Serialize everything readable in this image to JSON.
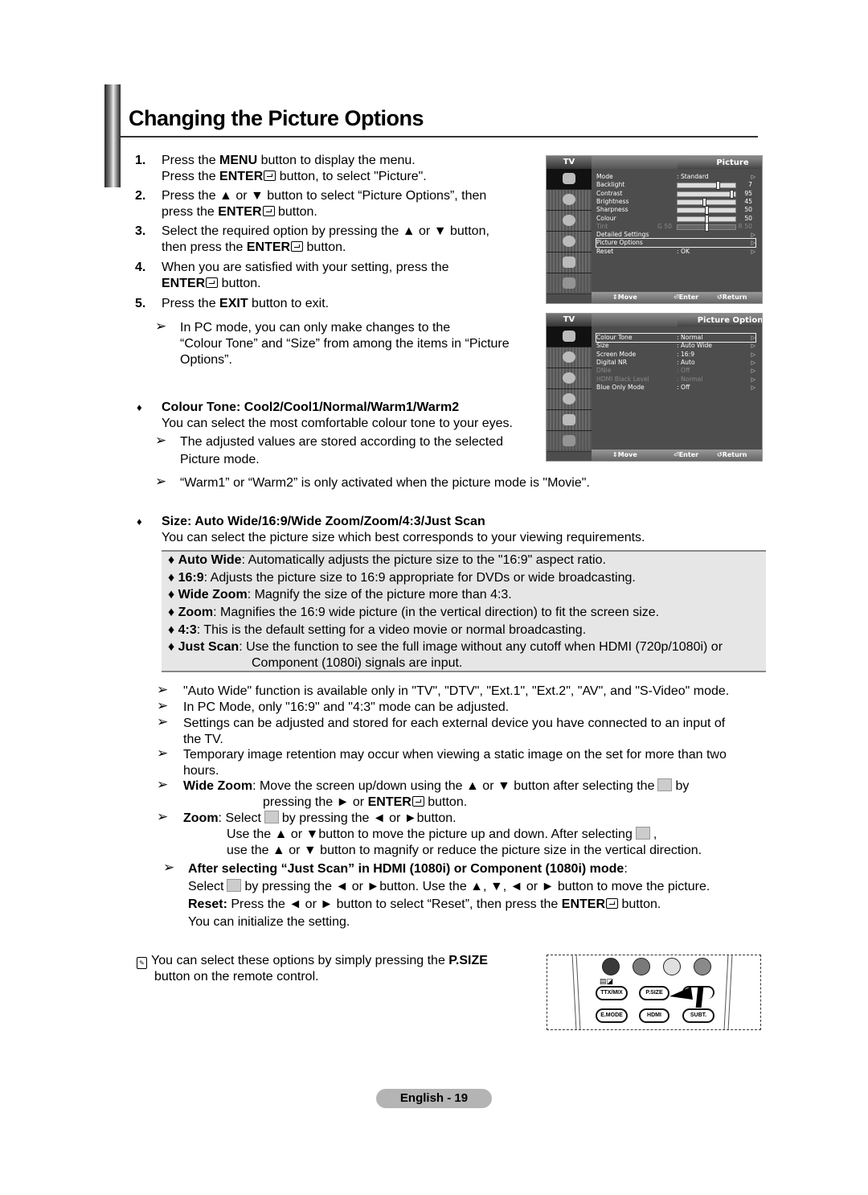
{
  "page": {
    "title": "Changing the Picture Options",
    "footer": "English - 19"
  },
  "steps": [
    {
      "num": "1.",
      "parts": [
        "Press the ",
        "MENU",
        " button to display the menu."
      ],
      "line2": [
        "Press the ",
        "ENTER",
        " button, to select \"Picture\"."
      ]
    },
    {
      "num": "2.",
      "text_a": "Press the ▲ or ▼ button to select “Picture Options”, then",
      "text_b_pre": "press the ",
      "text_b_bold": "ENTER",
      "text_b_post": " button."
    },
    {
      "num": "3.",
      "text_a": "Select the required option by pressing the ▲ or ▼ button,",
      "text_b_pre": "then press the ",
      "text_b_bold": "ENTER",
      "text_b_post": " button."
    },
    {
      "num": "4.",
      "text_a": "When you are satisfied with your setting, press the",
      "text_b_pre": "",
      "text_b_bold": "ENTER",
      "text_b_post": " button."
    },
    {
      "num": "5.",
      "pre": "Press the ",
      "bold": "EXIT",
      "post": " button to exit."
    }
  ],
  "notes": {
    "pc_mode": [
      "In PC mode, you can only make changes to the",
      "“Colour Tone” and “Size” from among the items in “Picture",
      "Options”."
    ],
    "stored": [
      "The adjusted values are stored according to the selected",
      "Picture mode."
    ],
    "warm": "“Warm1” or “Warm2” is only activated when the picture mode is \"Movie\".",
    "arrow_glyph": "➢"
  },
  "colour_tone": {
    "heading": "Colour Tone: Cool2/Cool1/Normal/Warm1/Warm2",
    "desc": "You can select the most comfortable colour tone to your eyes."
  },
  "size": {
    "heading": "Size: Auto Wide/16:9/Wide Zoom/Zoom/4:3/Just Scan",
    "desc": "You can select the picture size which best corresponds to your viewing requirements.",
    "options": [
      {
        "name": "Auto Wide",
        "desc": ": Automatically adjusts the picture size to the \"16:9\" aspect ratio."
      },
      {
        "name": "16:9",
        "desc": ": Adjusts the picture size to 16:9 appropriate for DVDs or wide broadcasting."
      },
      {
        "name": "Wide Zoom",
        "desc": ": Magnify the size of the picture more than 4:3."
      },
      {
        "name": "Zoom",
        "desc": ": Magnifies the 16:9 wide picture (in the vertical direction) to fit the screen size."
      },
      {
        "name": "4:3",
        "desc": ": This is the default setting for a video movie or normal broadcasting."
      },
      {
        "name": "Just Scan",
        "desc": ": Use the function to see the full image without any cutoff when HDMI (720p/1080i) or",
        "desc2": "Component (1080i) signals are input."
      }
    ]
  },
  "size_notes": [
    "\"Auto Wide\" function is available only in \"TV\", \"DTV\", \"Ext.1\", \"Ext.2\", \"AV\", and \"S-Video\" mode.",
    "In PC Mode, only \"16:9\" and \"4:3\" mode can be adjusted.",
    "Settings can be adjusted and stored for each external device you have connected to an input of",
    "the TV.",
    "Temporary image retention may occur when viewing a static image on the set for more than two",
    "hours."
  ],
  "wide_zoom_note": {
    "bold": "Wide Zoom",
    "line1_a": ": Move the screen up/down using the ▲ or ▼ button after selecting the",
    "line1_b": "by",
    "line2_a": "pressing the ► or ",
    "line2_bold": "ENTER",
    "line2_b": " button."
  },
  "zoom_note": {
    "bold": "Zoom",
    "line1_a": ": Select",
    "line1_b": "by pressing the ◄ or ►button.",
    "line2_a": "Use the ▲ or ▼button to move the picture up and down. After selecting",
    "line2_b": ",",
    "line3": "use the ▲ or ▼ button to magnify or reduce the picture size in the vertical direction."
  },
  "just_scan_note": {
    "heading_bold": "After selecting “Just Scan” in HDMI (1080i) or Component (1080i) mode",
    "heading_tail": ":",
    "line1_a": "Select",
    "line1_b": "by pressing the ◄ or ►button. Use the ▲, ▼, ◄ or ► button to move the picture.",
    "reset_bold": "Reset:",
    "reset_a": " Press the ◄ or ► button to select “Reset”, then press the ",
    "reset_enter": "ENTER",
    "reset_b": " button.",
    "line3": "You can initialize the setting."
  },
  "psize_note": {
    "line1_a": "You can select these options by simply pressing the ",
    "line1_bold": "P.SIZE",
    "line2": "button on the remote control."
  },
  "osd_picture": {
    "tv_label": "TV",
    "title": "Picture",
    "items": [
      {
        "label": "Mode",
        "value": ": Standard",
        "arrow": "▷"
      },
      {
        "label": "Backlight",
        "slider": 0.7,
        "number": "7"
      },
      {
        "label": "Contrast",
        "slider": 0.95,
        "number": "95"
      },
      {
        "label": "Brightness",
        "slider": 0.45,
        "number": "45"
      },
      {
        "label": "Sharpness",
        "slider": 0.5,
        "number": "50"
      },
      {
        "label": "Colour",
        "slider": 0.5,
        "number": "50"
      },
      {
        "label": "Tint",
        "tint_left": "G 50",
        "tint_right": "R 50",
        "slider": 0.5,
        "dim": true
      },
      {
        "label": "Detailed Settings",
        "arrow": "▷"
      },
      {
        "label": "Picture Options",
        "arrow": "▷",
        "selected": true
      },
      {
        "label": "Reset",
        "value": ": OK",
        "arrow": "▷"
      }
    ],
    "footer": {
      "move": "Move",
      "enter": "Enter",
      "return": "Return"
    }
  },
  "osd_options": {
    "tv_label": "TV",
    "title": "Picture Options",
    "items": [
      {
        "label": "Colour Tone",
        "value": ": Normal",
        "selected": true
      },
      {
        "label": "Size",
        "value": ": Auto Wide"
      },
      {
        "label": "Screen Mode",
        "value": ": 16:9"
      },
      {
        "label": "Digital NR",
        "value": ": Auto"
      },
      {
        "label": "DNIe",
        "value": ": Off",
        "dim": true
      },
      {
        "label": "HDMI Black Level",
        "value": ": Normal",
        "dim": true
      },
      {
        "label": "Blue Only Mode",
        "value": ": Off"
      }
    ],
    "footer": {
      "move": "Move",
      "enter": "Enter",
      "return": "Return"
    }
  },
  "remote": {
    "row1": [
      "TTX/MIX",
      "P.SIZE",
      ""
    ],
    "row2": [
      "E.MODE",
      "HDMI",
      "SUBT."
    ],
    "colors": [
      "#3a3a3a",
      "#7a7a7a",
      "#e0e0e0",
      "#8a8a8a"
    ]
  }
}
